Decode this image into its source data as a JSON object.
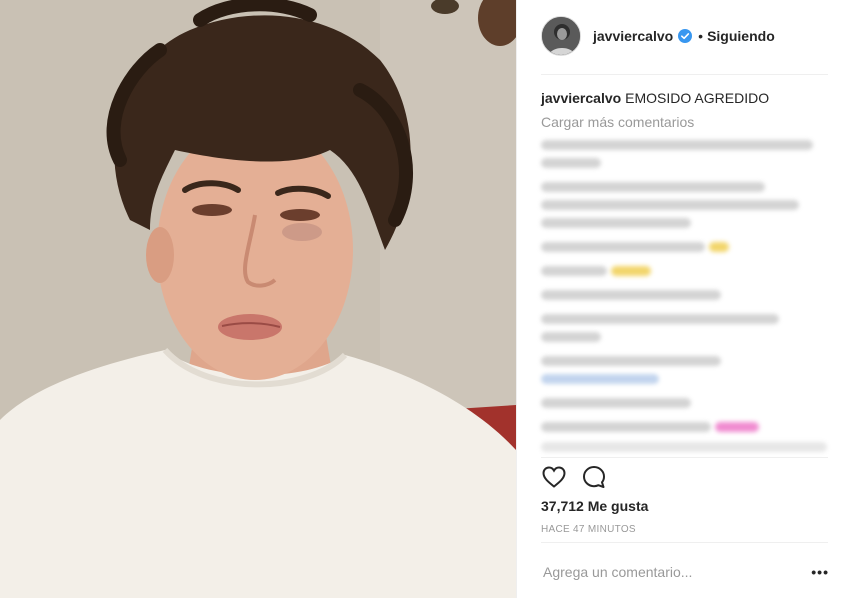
{
  "post": {
    "username": "javviercalvo",
    "verified_icon": "verified-badge-icon",
    "separator": "•",
    "follow_status": "Siguiendo",
    "caption_user": "javviercalvo",
    "caption_text": "EMOSIDO AGREDIDO",
    "load_more_label": "Cargar más comentarios",
    "likes": "37,712 Me gusta",
    "time_ago": "HACE 47 MINUTOS",
    "comment_placeholder": "Agrega un comentario...",
    "more_options": "•••"
  },
  "icons": {
    "like": "heart-icon",
    "comment": "comment-icon",
    "more": "more-options-icon"
  },
  "colors": {
    "text": "#262626",
    "muted": "#999999",
    "verified": "#3897f0",
    "divider": "#efefef"
  }
}
